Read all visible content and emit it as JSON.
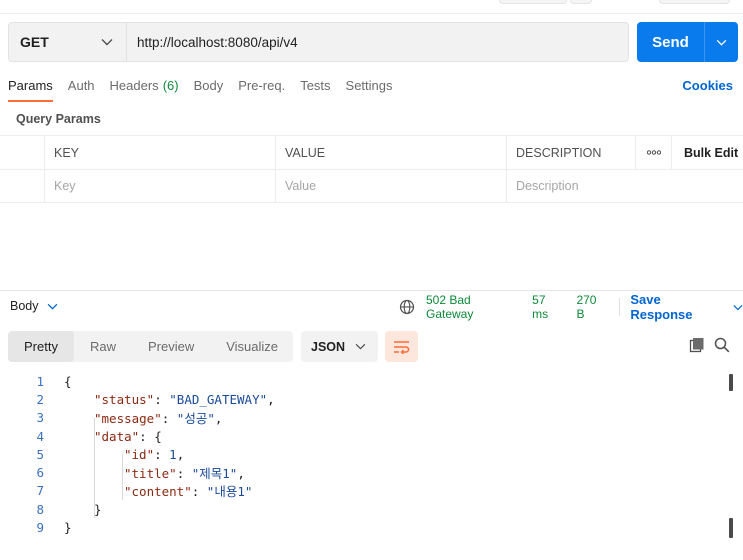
{
  "request": {
    "method": "GET",
    "url": "http://localhost:8080/api/v4",
    "send_label": "Send"
  },
  "request_tabs": [
    {
      "label": "Params",
      "count": "",
      "active": true
    },
    {
      "label": "Auth",
      "count": "",
      "active": false
    },
    {
      "label": "Headers",
      "count": "(6)",
      "active": false
    },
    {
      "label": "Body",
      "count": "",
      "active": false
    },
    {
      "label": "Pre-req.",
      "count": "",
      "active": false
    },
    {
      "label": "Tests",
      "count": "",
      "active": false
    },
    {
      "label": "Settings",
      "count": "",
      "active": false
    }
  ],
  "cookies_label": "Cookies",
  "query_params": {
    "title": "Query Params",
    "headers": {
      "key": "KEY",
      "value": "VALUE",
      "description": "DESCRIPTION",
      "more": "ooo",
      "bulk_edit": "Bulk Edit"
    },
    "placeholders": {
      "key": "Key",
      "value": "Value",
      "description": "Description"
    }
  },
  "response": {
    "body_label": "Body",
    "status": "502 Bad Gateway",
    "time": "57 ms",
    "size": "270 B",
    "save_label": "Save Response",
    "tabs": [
      {
        "label": "Pretty",
        "active": true
      },
      {
        "label": "Raw",
        "active": false
      },
      {
        "label": "Preview",
        "active": false
      },
      {
        "label": "Visualize",
        "active": false
      }
    ],
    "format": "JSON",
    "code_lines": [
      {
        "num": "1",
        "indent": 0,
        "parts": [
          [
            "p",
            "{"
          ]
        ]
      },
      {
        "num": "2",
        "indent": 1,
        "parts": [
          [
            "k",
            "\"status\""
          ],
          [
            "p",
            ": "
          ],
          [
            "s",
            "\"BAD_GATEWAY\""
          ],
          [
            "p",
            ","
          ]
        ]
      },
      {
        "num": "3",
        "indent": 1,
        "parts": [
          [
            "k",
            "\"message\""
          ],
          [
            "p",
            ": "
          ],
          [
            "s",
            "\"성공\""
          ],
          [
            "p",
            ","
          ]
        ]
      },
      {
        "num": "4",
        "indent": 1,
        "parts": [
          [
            "k",
            "\"data\""
          ],
          [
            "p",
            ": {"
          ]
        ]
      },
      {
        "num": "5",
        "indent": 2,
        "parts": [
          [
            "k",
            "\"id\""
          ],
          [
            "p",
            ": "
          ],
          [
            "n",
            "1"
          ],
          [
            "p",
            ","
          ]
        ]
      },
      {
        "num": "6",
        "indent": 2,
        "parts": [
          [
            "k",
            "\"title\""
          ],
          [
            "p",
            ": "
          ],
          [
            "s",
            "\"제목1\""
          ],
          [
            "p",
            ","
          ]
        ]
      },
      {
        "num": "7",
        "indent": 2,
        "parts": [
          [
            "k",
            "\"content\""
          ],
          [
            "p",
            ": "
          ],
          [
            "s",
            "\"내용1\""
          ]
        ]
      },
      {
        "num": "8",
        "indent": 1,
        "parts": [
          [
            "p",
            "}"
          ]
        ]
      },
      {
        "num": "9",
        "indent": 0,
        "parts": [
          [
            "p",
            "}"
          ]
        ]
      }
    ]
  },
  "colors": {
    "accent": "#097bed",
    "tab_underline": "#ff6c37",
    "status_green": "#0f8a3a",
    "link_blue": "#0265d2"
  }
}
